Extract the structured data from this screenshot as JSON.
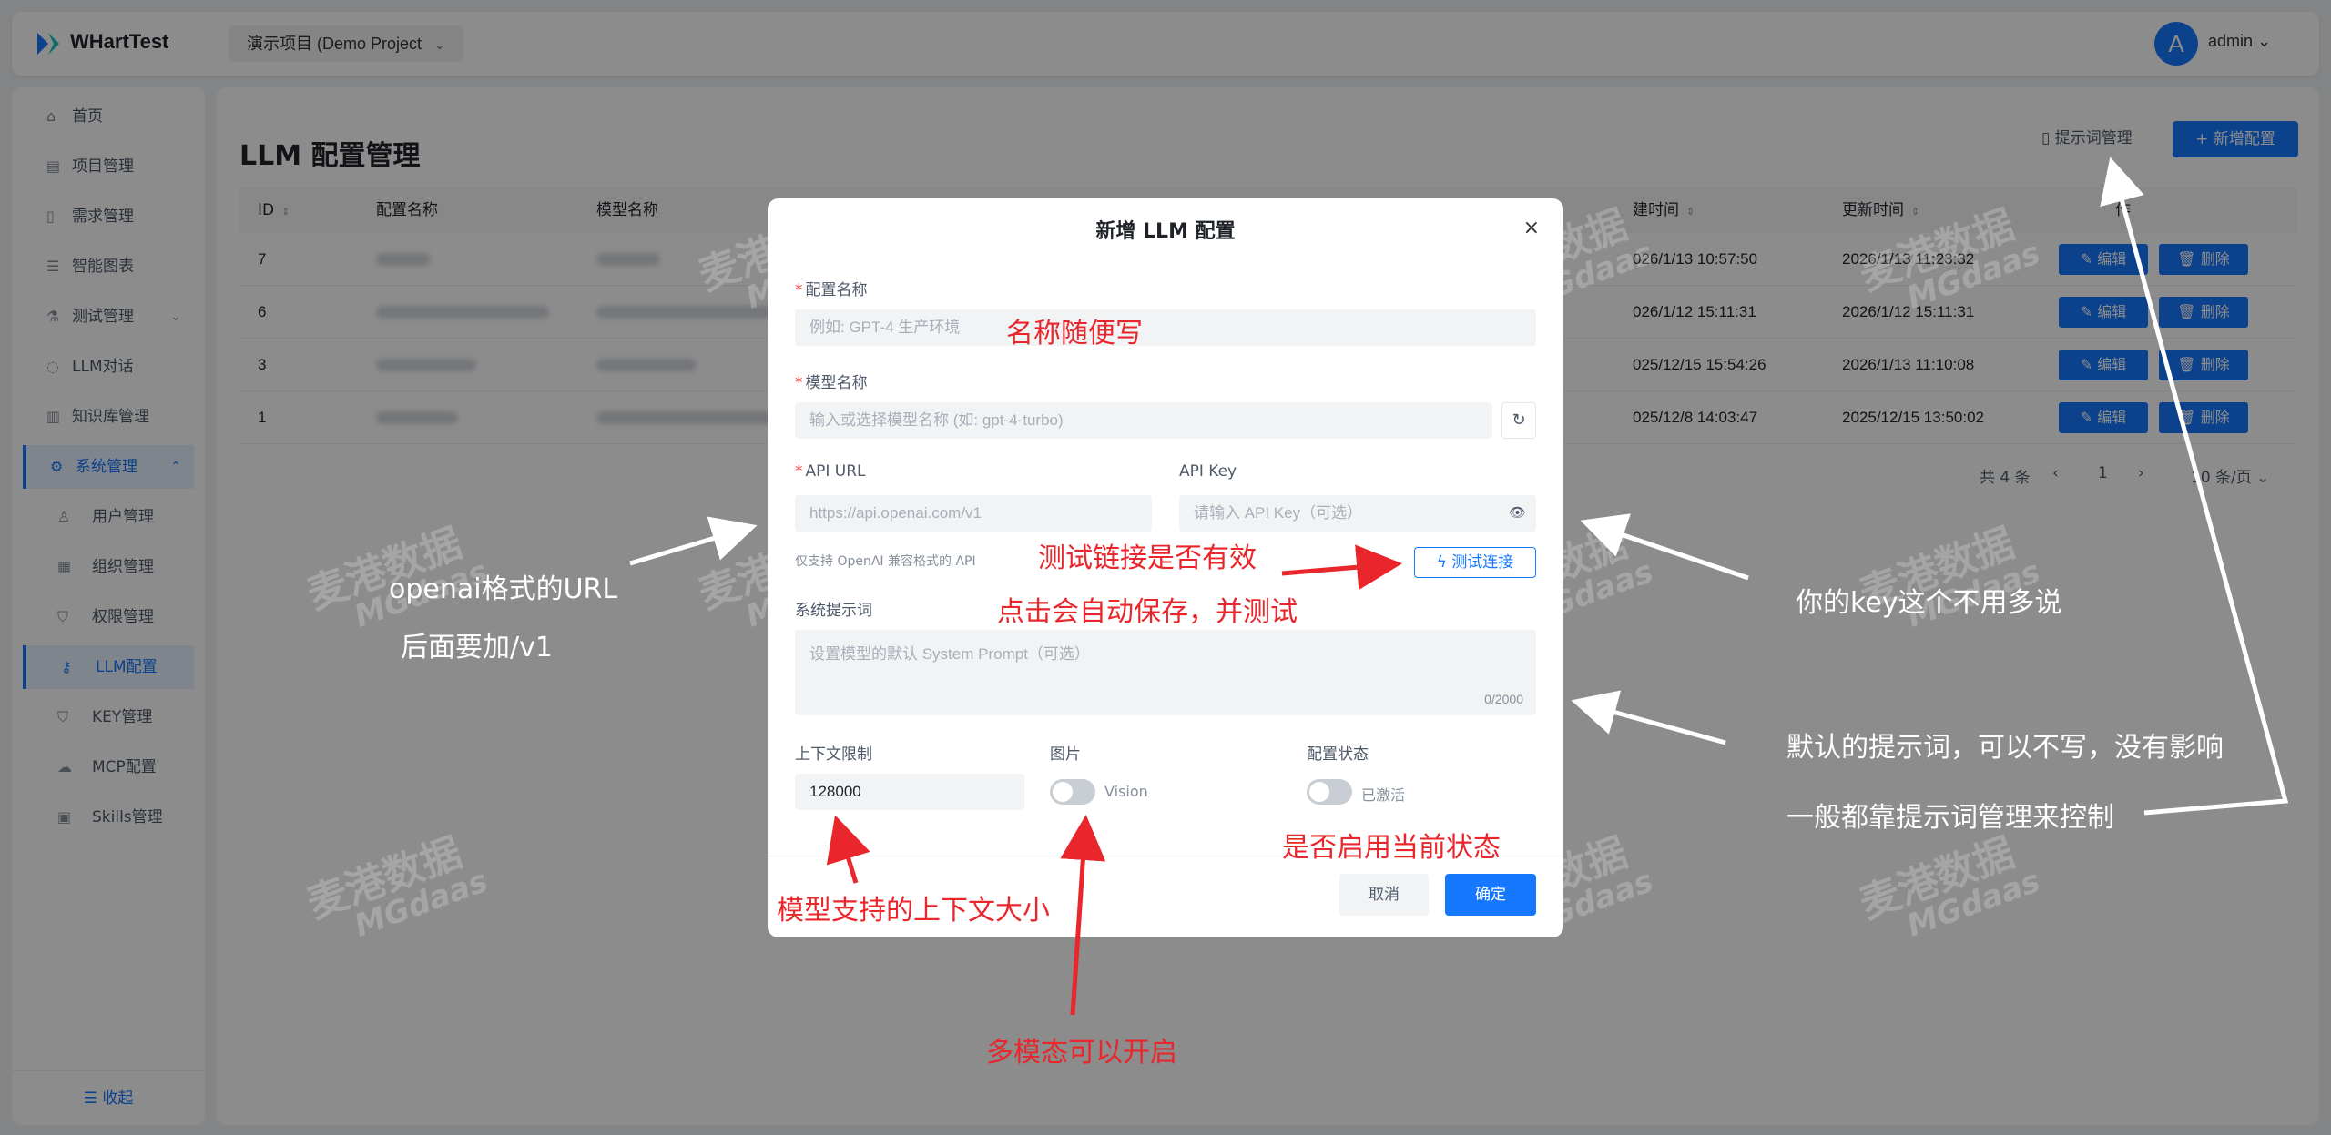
{
  "header": {
    "brand": "WHartTest",
    "project": "演示项目 (Demo Project",
    "avatar_letter": "A",
    "user": "admin"
  },
  "sidebar": {
    "items": [
      {
        "label": "首页"
      },
      {
        "label": "项目管理"
      },
      {
        "label": "需求管理"
      },
      {
        "label": "智能图表"
      },
      {
        "label": "测试管理"
      },
      {
        "label": "LLM对话"
      },
      {
        "label": "知识库管理"
      },
      {
        "label": "系统管理"
      },
      {
        "label": "用户管理"
      },
      {
        "label": "组织管理"
      },
      {
        "label": "权限管理"
      },
      {
        "label": "LLM配置"
      },
      {
        "label": "KEY管理"
      },
      {
        "label": "MCP配置"
      },
      {
        "label": "Skills管理"
      }
    ],
    "collapse": "收起"
  },
  "page": {
    "title": "LLM 配置管理",
    "prompt_button": "提示词管理",
    "add_button": "+ 新增配置"
  },
  "table": {
    "columns": [
      "ID",
      "配置名称",
      "模型名称",
      "建时间",
      "更新时间",
      "作"
    ],
    "rows": [
      {
        "id": "7",
        "created": "026/1/13 10:57:50",
        "updated": "2026/1/13 11:23:32"
      },
      {
        "id": "6",
        "created": "026/1/12 15:11:31",
        "updated": "2026/1/12 15:11:31"
      },
      {
        "id": "3",
        "created": "025/12/15 15:54:26",
        "updated": "2026/1/13 11:10:08"
      },
      {
        "id": "1",
        "created": "025/12/8 14:03:47",
        "updated": "2025/12/15 13:50:02"
      }
    ],
    "edit_label": "编辑",
    "delete_label": "删除",
    "pager": {
      "total": "共 4 条",
      "page": "1",
      "size": "10 条/页"
    }
  },
  "modal": {
    "title": "新增 LLM 配置",
    "close": "×",
    "name_label": "配置名称",
    "name_placeholder": "例如: GPT-4 生产环境",
    "model_label": "模型名称",
    "model_placeholder": "输入或选择模型名称 (如: gpt-4-turbo)",
    "api_url_label": "API URL",
    "api_url_placeholder": "https://api.openai.com/v1",
    "api_key_label": "API Key",
    "api_key_placeholder": "请输入 API Key（可选）",
    "compat_hint": "仅支持 OpenAI 兼容格式的 API",
    "test_button": "测试连接",
    "prompt_label": "系统提示词",
    "prompt_placeholder": "设置模型的默认 System Prompt（可选）",
    "prompt_counter": "0/2000",
    "context_label": "上下文限制",
    "context_value": "128000",
    "image_label": "图片",
    "vision_text": "Vision",
    "status_label": "配置状态",
    "status_text": "已激活",
    "cancel": "取消",
    "ok": "确定"
  },
  "annotations": {
    "name_note": "名称随便写",
    "test_note_1": "测试链接是否有效",
    "test_note_2": "点击会自动保存，并测试",
    "url_note_1": "openai格式的URL",
    "url_note_2": "后面要加/v1",
    "key_note": "你的key这个不用多说",
    "prompt_note_1": "默认的提示词，可以不写，没有影响",
    "prompt_note_2": "一般都靠提示词管理来控制",
    "status_note": "是否启用当前状态",
    "context_note": "模型支持的上下文大小",
    "vision_note": "多模态可以开启"
  },
  "watermark": {
    "cn": "麦港数据",
    "en": "MGdaas"
  },
  "colors": {
    "primary": "#1677ff",
    "annotation_red": "#e8262b",
    "required": "#f53f3f"
  }
}
